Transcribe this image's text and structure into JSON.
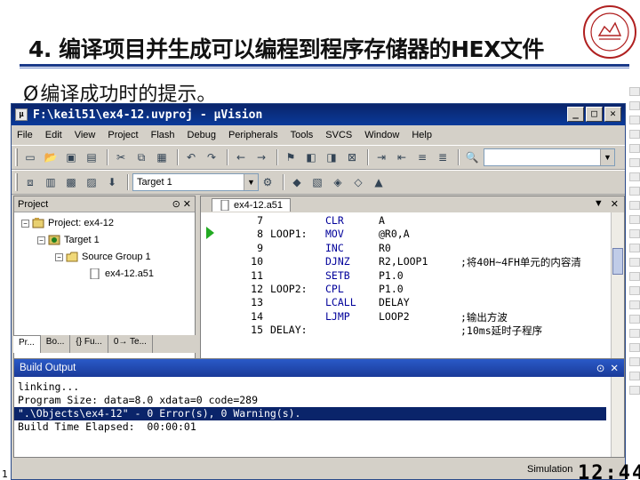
{
  "slide": {
    "title": "4. 编译项目并生成可以编程到程序存储器的HEX文件",
    "bullet": "编译成功时的提示。",
    "bullet_marker": "Ø",
    "page_number": "1",
    "clock": "12:44"
  },
  "window": {
    "title": "F:\\keil51\\ex4-12.uvproj - μVision"
  },
  "menu": [
    "File",
    "Edit",
    "View",
    "Project",
    "Flash",
    "Debug",
    "Peripherals",
    "Tools",
    "SVCS",
    "Window",
    "Help"
  ],
  "toolbar2": {
    "target_combo": "Target 1"
  },
  "project_panel": {
    "header": "Project",
    "tree": [
      {
        "label": "Project: ex4-12"
      },
      {
        "label": "Target 1"
      },
      {
        "label": "Source Group 1"
      },
      {
        "label": "ex4-12.a51"
      }
    ],
    "tabs": [
      "Pr...",
      "Bo...",
      "{} Fu...",
      "0→ Te..."
    ]
  },
  "editor": {
    "tab_label": "ex4-12.a51",
    "lines": [
      {
        "num": "7",
        "label": "",
        "op": "CLR",
        "arg": "A",
        "comment": ""
      },
      {
        "num": "8",
        "label": "LOOP1:",
        "op": "MOV",
        "arg": "@R0,A",
        "comment": ""
      },
      {
        "num": "9",
        "label": "",
        "op": "INC",
        "arg": "R0",
        "comment": ""
      },
      {
        "num": "10",
        "label": "",
        "op": "DJNZ",
        "arg": "R2,LOOP1",
        "comment": ";将40H~4FH单元的内容清"
      },
      {
        "num": "11",
        "label": "",
        "op": "SETB",
        "arg": "P1.0",
        "comment": ""
      },
      {
        "num": "12",
        "label": "LOOP2:",
        "op": "CPL",
        "arg": "P1.0",
        "comment": ""
      },
      {
        "num": "13",
        "label": "",
        "op": "LCALL",
        "arg": "DELAY",
        "comment": ""
      },
      {
        "num": "14",
        "label": "",
        "op": "LJMP",
        "arg": "LOOP2",
        "comment": ";输出方波"
      },
      {
        "num": "15",
        "label": "DELAY:",
        "op": "",
        "arg": "",
        "comment": ";10ms延时子程序"
      }
    ]
  },
  "build_output": {
    "header": "Build Output",
    "lines": [
      "linking...",
      "Program Size: data=8.0 xdata=0 code=289",
      "\".\\Objects\\ex4-12\" - 0 Error(s), 0 Warning(s).",
      "Build Time Elapsed:  00:00:01"
    ],
    "selected_index": 2
  },
  "status": {
    "mode": "Simulation"
  }
}
